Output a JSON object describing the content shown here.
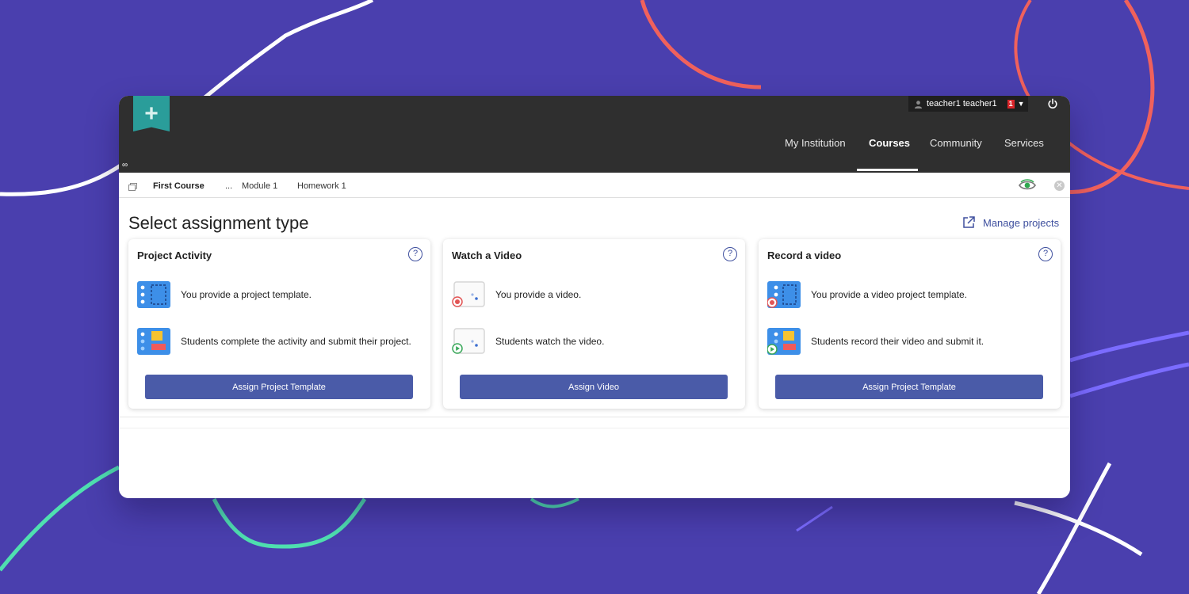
{
  "header": {
    "user_name": "teacher1 teacher1",
    "notification_count": "1",
    "nav": [
      {
        "label": "My Institution",
        "active": false
      },
      {
        "label": "Courses",
        "active": true
      },
      {
        "label": "Community",
        "active": false
      },
      {
        "label": "Services",
        "active": false
      }
    ]
  },
  "breadcrumb": {
    "course": "First Course",
    "ellipsis": "...",
    "module": "Module 1",
    "item": "Homework 1"
  },
  "page": {
    "title": "Select assignment type",
    "manage_label": "Manage projects"
  },
  "cards": [
    {
      "title": "Project Activity",
      "help": "?",
      "rows": [
        "You provide a project template.",
        "Students complete the activity and submit their project."
      ],
      "button": "Assign Project Template"
    },
    {
      "title": "Watch a Video",
      "help": "?",
      "rows": [
        "You provide a video.",
        "Students watch the video."
      ],
      "button": "Assign Video"
    },
    {
      "title": "Record a video",
      "help": "?",
      "rows": [
        "You provide a video project template.",
        "Students record their video and submit it."
      ],
      "button": "Assign Project Template"
    }
  ],
  "colors": {
    "background": "#4a3fae",
    "topbar": "#2f2f2f",
    "accent": "#4a5ba8",
    "logo": "#2a9d9a"
  },
  "icons": [
    "add-logo-icon",
    "link-icon",
    "user-icon",
    "power-icon",
    "tab-icon",
    "eye-icon",
    "close-icon",
    "external-link-icon",
    "help-icon"
  ]
}
